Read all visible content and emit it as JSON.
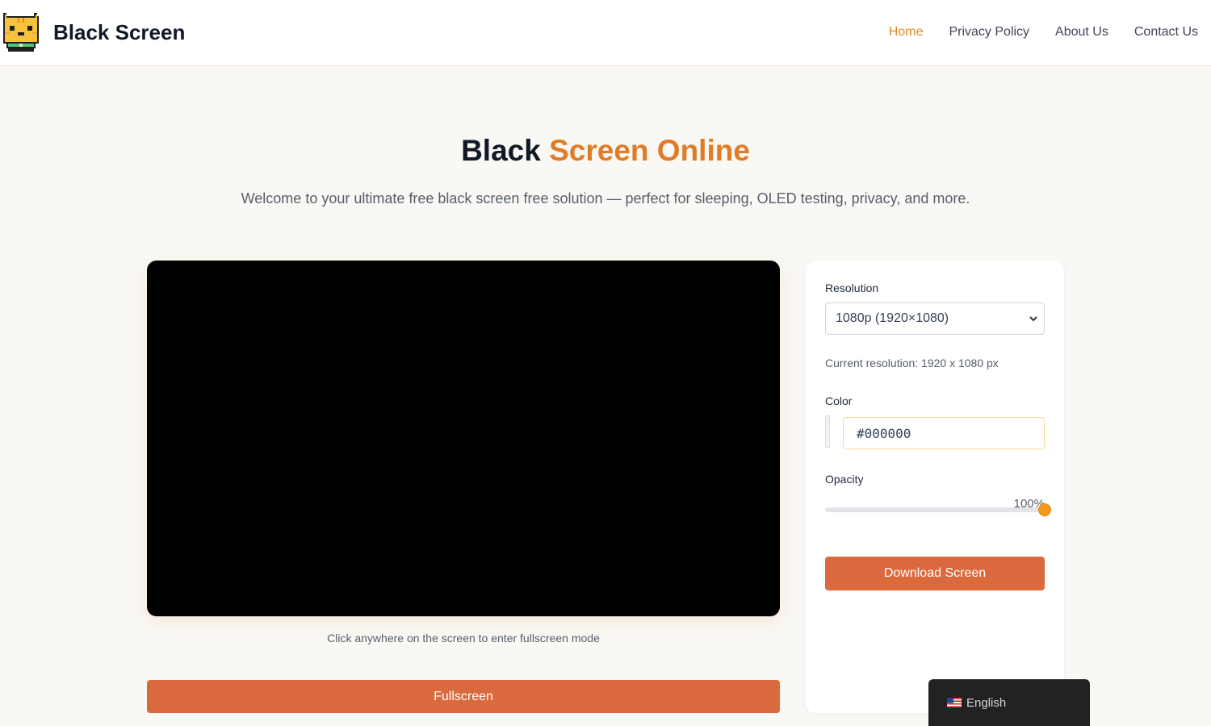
{
  "header": {
    "brand": "Black Screen",
    "nav": [
      {
        "label": "Home",
        "active": true
      },
      {
        "label": "Privacy Policy",
        "active": false
      },
      {
        "label": "About Us",
        "active": false
      },
      {
        "label": "Contact Us",
        "active": false
      }
    ]
  },
  "hero": {
    "title_part1": "Black",
    "title_part2": "Screen Online",
    "subtitle": "Welcome to your ultimate free black screen free solution — perfect for sleeping, OLED testing, privacy, and more."
  },
  "preview": {
    "screen_color": "#000000",
    "hint": "Click anywhere on the screen to enter fullscreen mode",
    "fullscreen_label": "Fullscreen"
  },
  "settings": {
    "resolution_label": "Resolution",
    "resolution_value": "1080p (1920×1080)",
    "current_resolution": "Current resolution: 1920 x 1080 px",
    "color_label": "Color",
    "color_value": "#000000",
    "opacity_label": "Opacity",
    "opacity_value": "100%",
    "opacity_fraction": 1.0,
    "download_label": "Download Screen"
  },
  "language": {
    "label": "English",
    "icon": "us-flag-icon"
  },
  "colors": {
    "accent": "#e07b26",
    "nav_active": "#e08a1e",
    "button": "#da6a3d",
    "background": "#f9f8f4"
  }
}
